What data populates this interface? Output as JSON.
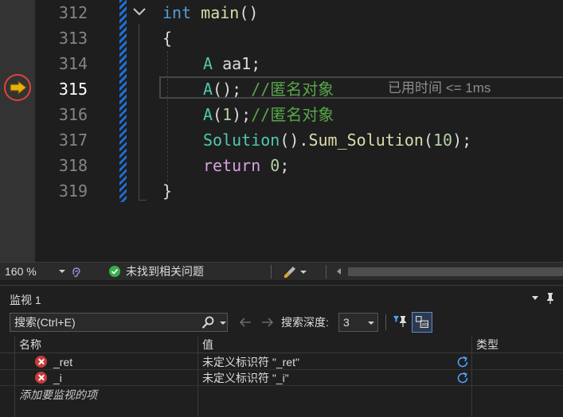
{
  "editor": {
    "lines": [
      {
        "num": "312",
        "text": "int main()"
      },
      {
        "num": "313",
        "text": "{"
      },
      {
        "num": "314",
        "text": "A aa1;"
      },
      {
        "num": "315",
        "text": "A(); //匿名对象"
      },
      {
        "num": "316",
        "text": "A(1);//匿名对象"
      },
      {
        "num": "317",
        "text": "Solution().Sum_Solution(10);"
      },
      {
        "num": "318",
        "text": "return 0;"
      },
      {
        "num": "319",
        "text": "}"
      }
    ],
    "tokens": {
      "l312": [
        "int",
        " ",
        "main",
        "()"
      ],
      "l313": [
        "{"
      ],
      "l314": [
        "A",
        " aa1;"
      ],
      "l315": [
        "A",
        "(); ",
        "//匿名对象"
      ],
      "l316": [
        "A",
        "(",
        "1",
        ");",
        "//匿名对象"
      ],
      "l317": [
        "Solution",
        "().",
        "Sum_Solution",
        "(",
        "10",
        ");"
      ],
      "l318": [
        "return",
        " ",
        "0",
        ";"
      ],
      "l319": [
        "}"
      ]
    },
    "current_line": "315",
    "perf_tip": "已用时间 <= 1ms",
    "icons": {
      "current_statement": "current-statement-arrow-icon",
      "fold": "chevron-down-icon"
    },
    "colors": {
      "keyword": "#569cd6",
      "function": "#dcdcaa",
      "type": "#4ec9b0",
      "number": "#b5cea8",
      "comment": "#57a64a",
      "control": "#d8a0df",
      "breakpoint_ring": "#e0423c",
      "change_bar": "#1d6fd4"
    }
  },
  "status": {
    "zoom": "160 %",
    "issues": "未找到相关问题"
  },
  "watch": {
    "title": "监视 1",
    "search_placeholder": "搜索(Ctrl+E)",
    "depth_label": "搜索深度:",
    "depth_value": "3",
    "columns": {
      "name": "名称",
      "value": "值",
      "type": "类型"
    },
    "rows": [
      {
        "name": "_ret",
        "value": "未定义标识符 \"_ret\"",
        "type": ""
      },
      {
        "name": "_i",
        "value": "未定义标识符 \"_i\"",
        "type": ""
      }
    ],
    "add_item": "添加要监视的项"
  }
}
